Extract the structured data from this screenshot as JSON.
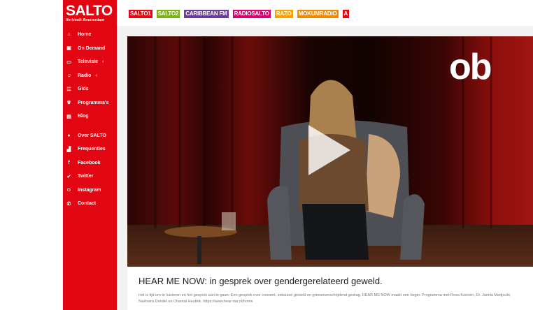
{
  "sidebar": {
    "logo": {
      "main": "SALTO",
      "sub": "Verbindt Amsterdam"
    },
    "items": [
      {
        "label": "Home",
        "icon": "home-icon",
        "glyph": "⌂",
        "chevron": false
      },
      {
        "label": "On Demand",
        "icon": "on-demand-icon",
        "glyph": "▣",
        "chevron": false
      },
      {
        "label": "Televisie",
        "icon": "tv-icon",
        "glyph": "▭",
        "chevron": true
      },
      {
        "label": "Radio",
        "icon": "music-icon",
        "glyph": "♫",
        "chevron": true
      },
      {
        "label": "Gids",
        "icon": "guide-icon",
        "glyph": "☰",
        "chevron": false
      },
      {
        "label": "Programma's",
        "icon": "programs-icon",
        "glyph": "♛",
        "chevron": false
      },
      {
        "label": "Blog",
        "icon": "blog-icon",
        "glyph": "▤",
        "chevron": false
      }
    ],
    "items2": [
      {
        "label": "Over SALTO",
        "icon": "info-icon",
        "glyph": "●",
        "chevron": false
      },
      {
        "label": "Frequenties",
        "icon": "signal-icon",
        "glyph": "▟",
        "chevron": false
      },
      {
        "label": "Facebook",
        "icon": "facebook-icon",
        "glyph": "f",
        "chevron": false
      },
      {
        "label": "Twitter",
        "icon": "twitter-icon",
        "glyph": "✔",
        "chevron": false
      },
      {
        "label": "Instagram",
        "icon": "instagram-icon",
        "glyph": "◘",
        "chevron": false
      },
      {
        "label": "Contact",
        "icon": "phone-icon",
        "glyph": "✆",
        "chevron": false
      }
    ]
  },
  "channels": [
    {
      "label": "SALTO1",
      "bg": "#e20613",
      "fg": "#ffffff"
    },
    {
      "label": "SALTO2",
      "bg": "#7ab317",
      "fg": "#ffffff"
    },
    {
      "label": "CARIBBEAN FM",
      "bg": "#6a3c9a",
      "fg": "#ffffff"
    },
    {
      "label": "RADIOSALTO",
      "bg": "#d7006e",
      "fg": "#ffffff"
    },
    {
      "label": "RAZO",
      "bg": "#f4a300",
      "fg": "#ffffff"
    },
    {
      "label": "MOKUMRADIO",
      "bg": "#f08a00",
      "fg": "#ffffff"
    },
    {
      "label": "A",
      "bg": "#e20613",
      "fg": "#ffffff"
    }
  ],
  "video": {
    "overlay_logo": "ob"
  },
  "article": {
    "title": "HEAR ME NOW: in gesprek over gendergerelateerd geweld.",
    "description": "Het is tijd om te luisteren en het gesprek aan te gaan. Een gesprek over consent, seksueel geweld en grensoverschrijdend gedrag. HEAR ME NOW maakt een begin. Programma met Rosa Koenen, Dr. Jamila Medjoubi, Nashaira Dandel en Chantal Heutink. https://www.hear-me.nl/home"
  },
  "colors": {
    "brand_red": "#e20613"
  }
}
